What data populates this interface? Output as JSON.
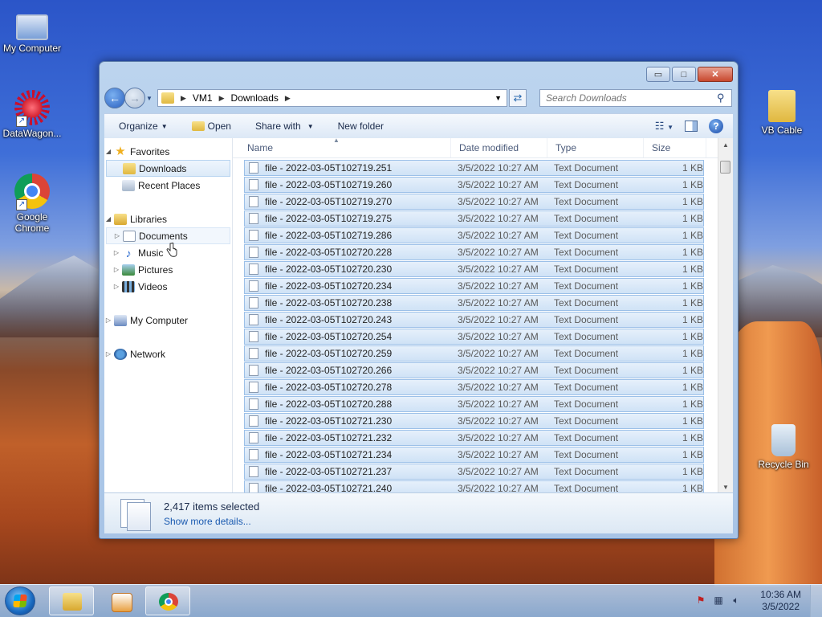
{
  "desktop": {
    "icons": [
      {
        "label": "My Computer",
        "icon": "computer-icon"
      },
      {
        "label": "DataWagon...",
        "icon": "datawagon-icon"
      },
      {
        "label": "Google Chrome",
        "icon": "chrome-icon"
      },
      {
        "label": "VB Cable",
        "icon": "folder-icon"
      },
      {
        "label": "Recycle Bin",
        "icon": "recycle-bin-icon"
      }
    ]
  },
  "window": {
    "caption": {
      "minimize": "▭",
      "maximize": "□",
      "close": "✕"
    },
    "address": {
      "segments": [
        "VM1",
        "Downloads"
      ]
    },
    "search": {
      "placeholder": "Search Downloads"
    },
    "toolbar": {
      "organize": "Organize",
      "open": "Open",
      "share_with": "Share with",
      "new_folder": "New folder"
    },
    "nav": {
      "favorites": "Favorites",
      "downloads": "Downloads",
      "recent_places": "Recent Places",
      "libraries": "Libraries",
      "documents": "Documents",
      "music": "Music",
      "pictures": "Pictures",
      "videos": "Videos",
      "my_computer": "My Computer",
      "network": "Network"
    },
    "columns": {
      "name": "Name",
      "date": "Date modified",
      "type": "Type",
      "size": "Size"
    },
    "files": [
      {
        "name": "file - 2022-03-05T102719.251",
        "date": "3/5/2022 10:27 AM",
        "type": "Text Document",
        "size": "1 KB"
      },
      {
        "name": "file - 2022-03-05T102719.260",
        "date": "3/5/2022 10:27 AM",
        "type": "Text Document",
        "size": "1 KB"
      },
      {
        "name": "file - 2022-03-05T102719.270",
        "date": "3/5/2022 10:27 AM",
        "type": "Text Document",
        "size": "1 KB"
      },
      {
        "name": "file - 2022-03-05T102719.275",
        "date": "3/5/2022 10:27 AM",
        "type": "Text Document",
        "size": "1 KB"
      },
      {
        "name": "file - 2022-03-05T102719.286",
        "date": "3/5/2022 10:27 AM",
        "type": "Text Document",
        "size": "1 KB"
      },
      {
        "name": "file - 2022-03-05T102720.228",
        "date": "3/5/2022 10:27 AM",
        "type": "Text Document",
        "size": "1 KB"
      },
      {
        "name": "file - 2022-03-05T102720.230",
        "date": "3/5/2022 10:27 AM",
        "type": "Text Document",
        "size": "1 KB"
      },
      {
        "name": "file - 2022-03-05T102720.234",
        "date": "3/5/2022 10:27 AM",
        "type": "Text Document",
        "size": "1 KB"
      },
      {
        "name": "file - 2022-03-05T102720.238",
        "date": "3/5/2022 10:27 AM",
        "type": "Text Document",
        "size": "1 KB"
      },
      {
        "name": "file - 2022-03-05T102720.243",
        "date": "3/5/2022 10:27 AM",
        "type": "Text Document",
        "size": "1 KB"
      },
      {
        "name": "file - 2022-03-05T102720.254",
        "date": "3/5/2022 10:27 AM",
        "type": "Text Document",
        "size": "1 KB"
      },
      {
        "name": "file - 2022-03-05T102720.259",
        "date": "3/5/2022 10:27 AM",
        "type": "Text Document",
        "size": "1 KB"
      },
      {
        "name": "file - 2022-03-05T102720.266",
        "date": "3/5/2022 10:27 AM",
        "type": "Text Document",
        "size": "1 KB"
      },
      {
        "name": "file - 2022-03-05T102720.278",
        "date": "3/5/2022 10:27 AM",
        "type": "Text Document",
        "size": "1 KB"
      },
      {
        "name": "file - 2022-03-05T102720.288",
        "date": "3/5/2022 10:27 AM",
        "type": "Text Document",
        "size": "1 KB"
      },
      {
        "name": "file - 2022-03-05T102721.230",
        "date": "3/5/2022 10:27 AM",
        "type": "Text Document",
        "size": "1 KB"
      },
      {
        "name": "file - 2022-03-05T102721.232",
        "date": "3/5/2022 10:27 AM",
        "type": "Text Document",
        "size": "1 KB"
      },
      {
        "name": "file - 2022-03-05T102721.234",
        "date": "3/5/2022 10:27 AM",
        "type": "Text Document",
        "size": "1 KB"
      },
      {
        "name": "file - 2022-03-05T102721.237",
        "date": "3/5/2022 10:27 AM",
        "type": "Text Document",
        "size": "1 KB"
      },
      {
        "name": "file - 2022-03-05T102721.240",
        "date": "3/5/2022 10:27 AM",
        "type": "Text Document",
        "size": "1 KB"
      }
    ],
    "details": {
      "count": "2,417 items selected",
      "more": "Show more details..."
    }
  },
  "taskbar": {
    "clock_time": "10:36 AM",
    "clock_date": "3/5/2022",
    "pinned": [
      "explorer-icon",
      "media-player-icon",
      "chrome-icon"
    ]
  },
  "colors": {
    "selection": "#cfe2f6",
    "selection_border": "#9cc0e8",
    "link": "#1a5ab0"
  }
}
